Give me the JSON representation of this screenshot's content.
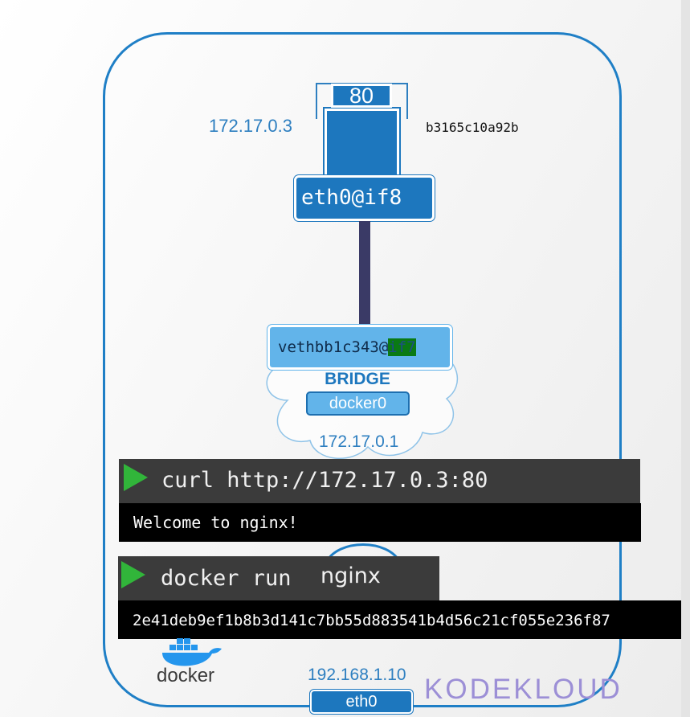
{
  "container": {
    "ip": "172.17.0.3",
    "id": "b3165c10a92b",
    "port": "80",
    "interface": "eth0@if8"
  },
  "bridge": {
    "veth_prefix": "vethbb1c343@",
    "veth_suffix": "if7",
    "label": "BRIDGE",
    "name": "docker0",
    "ip": "172.17.0.1"
  },
  "terminal": {
    "curl_command": "curl http://172.17.0.3:80",
    "curl_output": "Welcome to nginx!",
    "run_command_prefix": "docker run ",
    "run_command_image": "nginx",
    "run_output": "2e41deb9ef1b8b3d141c7bb55d883541b4d56c21cf055e236f87"
  },
  "host": {
    "ip": "192.168.1.10",
    "interface": "eth0"
  },
  "branding": {
    "docker_text": "docker",
    "kodekloud_text": "KODEKLOUD"
  },
  "colors": {
    "host_border": "#1f7fc6",
    "container_blue": "#1d77be",
    "veth_blue": "#62b4ea",
    "play_green": "#31b53a",
    "link_line": "#3a3a66"
  }
}
